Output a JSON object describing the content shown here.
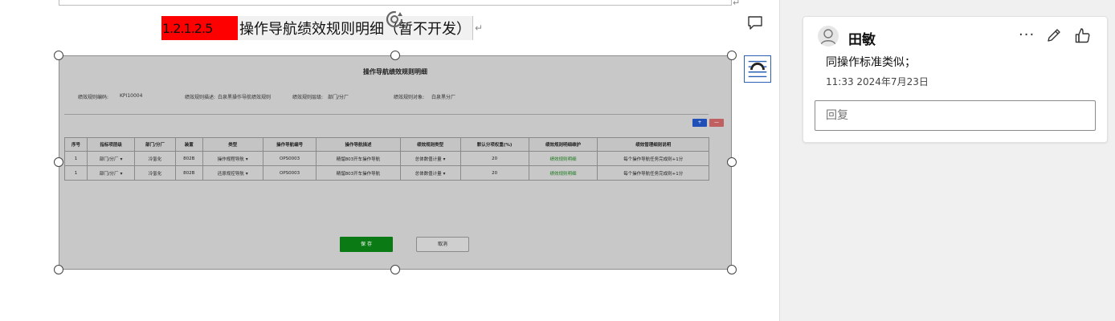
{
  "document": {
    "heading": {
      "number": "1.2.1.2.5",
      "title": "操作导航绩效规则明细（暂不开发）"
    },
    "paragraph_mark": "↵"
  },
  "embedded_image": {
    "title": "操作导航绩效规则明细",
    "meta": [
      {
        "label": "绩效规则编码:",
        "value": "KPI10004"
      },
      {
        "label": "绩效规则描述:",
        "value": "白泉黑操作导航绩效规则"
      },
      {
        "label": "绩效规则层级:",
        "value": "部门/分厂"
      },
      {
        "label": "绩效规则对象:",
        "value": "白泉黑分厂"
      }
    ],
    "add_button": "+",
    "delete_button": "—",
    "table": {
      "headers": [
        "序号",
        "指标项层级",
        "部门/分厂",
        "装置",
        "类型",
        "操作导航编号",
        "操作导航描述",
        "绩效规则类型",
        "默认分项权重(%)",
        "绩效规则明细维护",
        "绩效管理细则说明"
      ],
      "rows": [
        [
          "1",
          "部门/分厂",
          "冷氢化",
          "802B",
          "操作规程导航",
          "OPS0003",
          "精馏803开车操作导航",
          "总体数值计量",
          "20",
          "绩效规则明细",
          "每个操作导航任务完成则+1分"
        ],
        [
          "1",
          "部门/分厂",
          "冷氢化",
          "802B",
          "还原规控导航",
          "OPS0003",
          "精馏803开车操作导航",
          "总体数值计量",
          "20",
          "绩效规则明细",
          "每个操作导航任务完成则+1分"
        ]
      ]
    },
    "save_button": "保 存",
    "cancel_button": "取消"
  },
  "comments_pane": {
    "author": "田敏",
    "text": "同操作标准类似；",
    "time": "11:33 2024年7月23日",
    "reply_placeholder": "回复",
    "more_label": "···"
  },
  "colors": {
    "heading_highlight": "#ff0000",
    "save_button": "#0a7a14",
    "add_button": "#1f4fb7",
    "delete_button": "#c06060",
    "pane_background": "#f0f0f0"
  },
  "icons": [
    "rotate-handle-icon",
    "comment-icon",
    "layout-options-icon",
    "avatar-icon",
    "more-icon",
    "edit-icon",
    "like-icon"
  ]
}
